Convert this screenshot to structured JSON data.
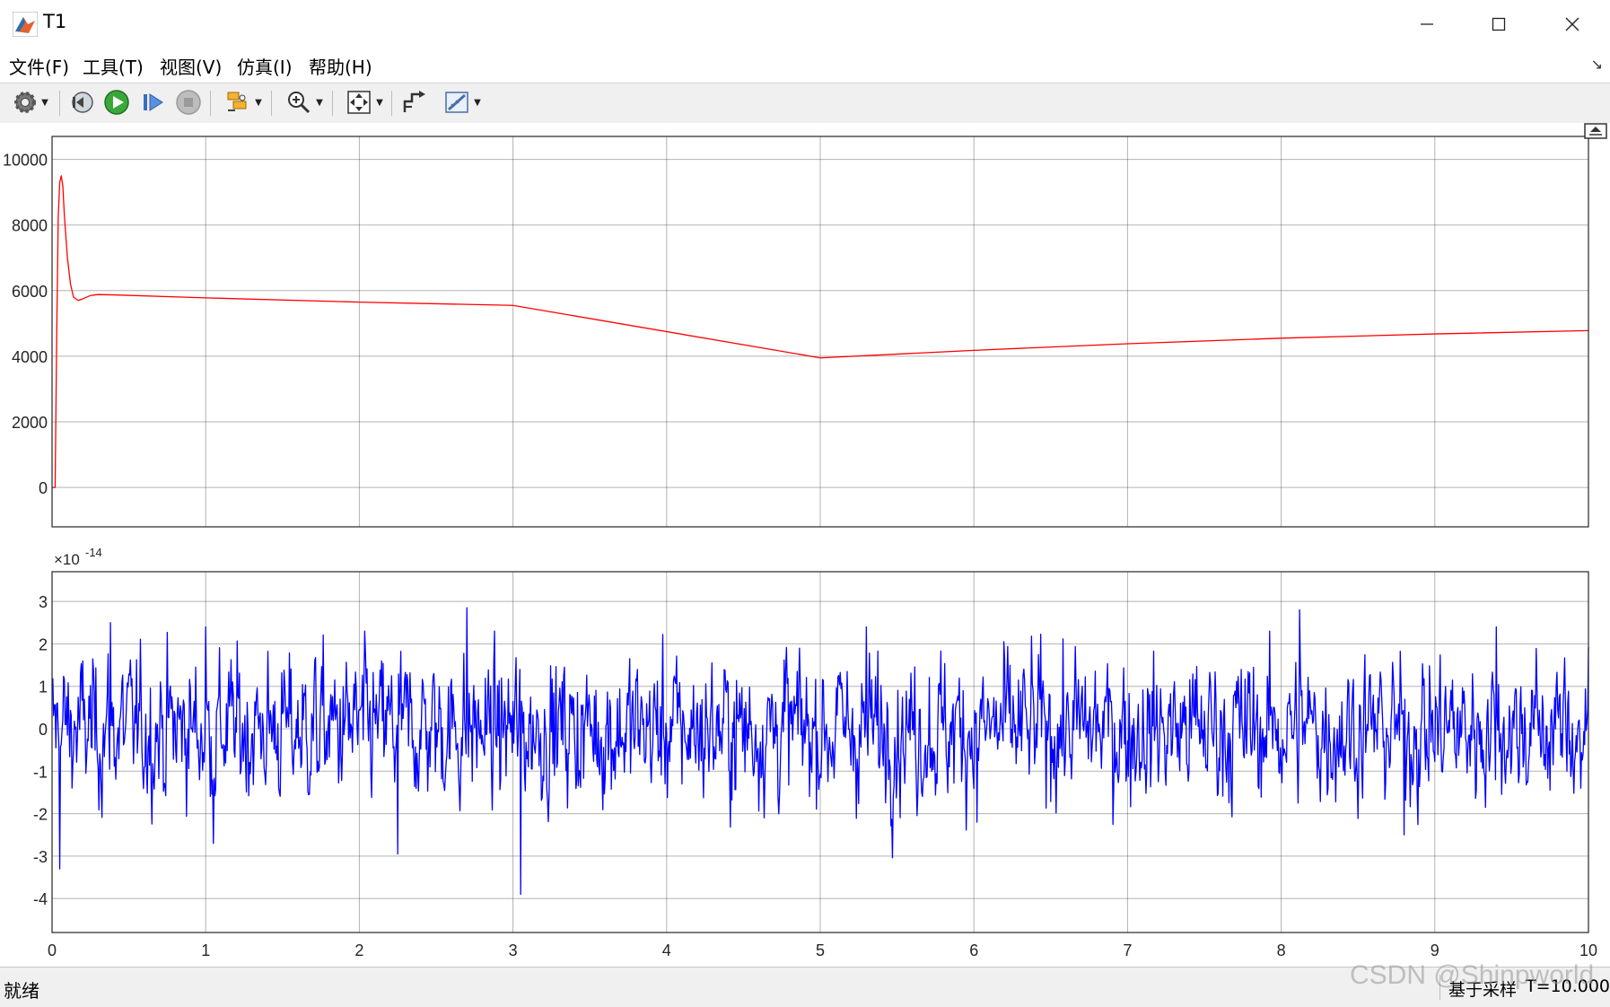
{
  "window": {
    "title": "T1"
  },
  "menu": {
    "items": [
      "文件(F)",
      "工具(T)",
      "视图(V)",
      "仿真(I)",
      "帮助(H)"
    ]
  },
  "toolbar": {
    "icons": [
      "gear-icon",
      "step-back-icon",
      "run-icon",
      "step-forward-icon",
      "stop-icon",
      "signal-select-icon",
      "zoom-icon",
      "autoscale-icon",
      "style-icon",
      "measure-icon"
    ]
  },
  "status": {
    "text": "就绪",
    "mode": "基于采样",
    "time": "T=10.000"
  },
  "watermark": "CSDN @Shinpworld",
  "colors": {
    "series1": "#ff0000",
    "series2": "#0000ff",
    "grid": "#262626"
  },
  "chart_data": [
    {
      "type": "line",
      "xlim": [
        0,
        10
      ],
      "ylim": [
        -1200,
        10700
      ],
      "yticks": [
        0,
        2000,
        4000,
        6000,
        8000,
        10000
      ],
      "xticks": [
        0,
        1,
        2,
        3,
        4,
        5,
        6,
        7,
        8,
        9,
        10
      ],
      "show_xticklabels": false,
      "grid": true,
      "series": [
        {
          "color": "#ff0000",
          "x": [
            0,
            0.02,
            0.03,
            0.04,
            0.05,
            0.06,
            0.07,
            0.08,
            0.1,
            0.12,
            0.14,
            0.17,
            0.2,
            0.25,
            0.3,
            0.4,
            1,
            2,
            3,
            5,
            6,
            7,
            8,
            9,
            10
          ],
          "y": [
            0,
            0,
            4500,
            8200,
            9300,
            9500,
            9200,
            8300,
            7000,
            6200,
            5800,
            5700,
            5750,
            5850,
            5880,
            5870,
            5780,
            5650,
            5550,
            3950,
            4180,
            4380,
            4550,
            4680,
            4780
          ]
        }
      ]
    },
    {
      "type": "line",
      "xlim": [
        0,
        10
      ],
      "ylim": [
        -4.8,
        3.7
      ],
      "yticks": [
        -4,
        -3,
        -2,
        -1,
        0,
        1,
        2,
        3
      ],
      "xticks": [
        0,
        1,
        2,
        3,
        4,
        5,
        6,
        7,
        8,
        9,
        10
      ],
      "y_exponent_label": "×10",
      "y_exponent_power": "-14",
      "grid": true,
      "series": [
        {
          "color": "#0000ff",
          "kind": "noise",
          "samples": 2000,
          "std": 0.85,
          "extremes": [
            {
              "x": 0.05,
              "y": -3.3
            },
            {
              "x": 0.38,
              "y": 2.5
            },
            {
              "x": 1.0,
              "y": 2.4
            },
            {
              "x": 1.05,
              "y": -2.7
            },
            {
              "x": 2.25,
              "y": -2.95
            },
            {
              "x": 2.7,
              "y": 2.85
            },
            {
              "x": 3.05,
              "y": -3.9
            },
            {
              "x": 5.3,
              "y": 2.4
            },
            {
              "x": 6.02,
              "y": -2.2
            },
            {
              "x": 8.12,
              "y": 2.8
            },
            {
              "x": 8.8,
              "y": -2.5
            },
            {
              "x": 9.4,
              "y": 2.4
            },
            {
              "x": 9.95,
              "y": -1.4
            }
          ]
        }
      ]
    }
  ]
}
